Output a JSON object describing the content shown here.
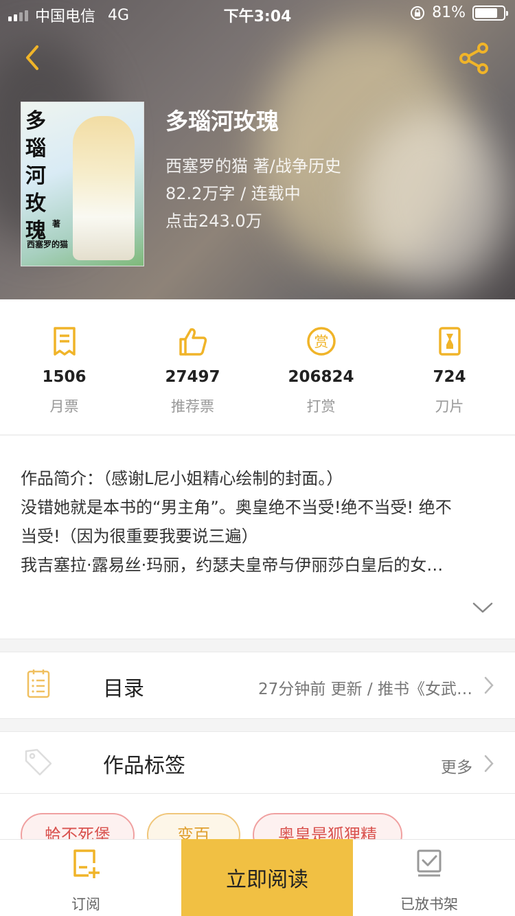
{
  "status_bar": {
    "carrier": "中国电信",
    "network": "4G",
    "time": "下午3:04",
    "battery": "81%"
  },
  "colors": {
    "accent": "#f1c043",
    "icon_yellow": "#f0b429",
    "tag_red": "#d9534f",
    "tag_yellow": "#e0a030"
  },
  "book": {
    "title": "多瑙河玫瑰",
    "author_genre": "西塞罗的猫  著/战争历史",
    "words_status": "82.2万字 / 连载中",
    "clicks": "点击243.0万",
    "cover": {
      "title_chars": [
        "多",
        "瑙",
        "河",
        "玫",
        "瑰"
      ],
      "zhu": "著",
      "author": "西塞罗的猫"
    }
  },
  "stats": [
    {
      "icon": "monthly-ticket-icon",
      "value": "1506",
      "label": "月票"
    },
    {
      "icon": "thumbs-up-icon",
      "value": "27497",
      "label": "推荐票"
    },
    {
      "icon": "reward-icon",
      "value": "206824",
      "label": "打赏"
    },
    {
      "icon": "blade-icon",
      "value": "724",
      "label": "刀片"
    }
  ],
  "intro": {
    "lines": [
      "作品简介：（感谢L尼小姐精心绘制的封面。）",
      "没错她就是本书的“男主角”。奥皇绝不当受!绝不当受! 绝不",
      "当受!（因为很重要我要说三遍）",
      "我吉塞拉·露易丝·玛丽，约瑟夫皇帝与伊丽莎白皇后的女…"
    ]
  },
  "catalog": {
    "icon": "catalog-icon",
    "title": "目录",
    "extra": "27分钟前 更新 / 推书《女武…"
  },
  "tags_row": {
    "icon": "tag-icon",
    "title": "作品标签",
    "more": "更多"
  },
  "tags": [
    {
      "label": "蛤不死堡",
      "style": "red"
    },
    {
      "label": "变百",
      "style": "yellow"
    },
    {
      "label": "奥皇是狐狸精",
      "style": "red"
    }
  ],
  "bottom_bar": {
    "subscribe": "订阅",
    "read": "立即阅读",
    "shelf": "已放书架"
  }
}
